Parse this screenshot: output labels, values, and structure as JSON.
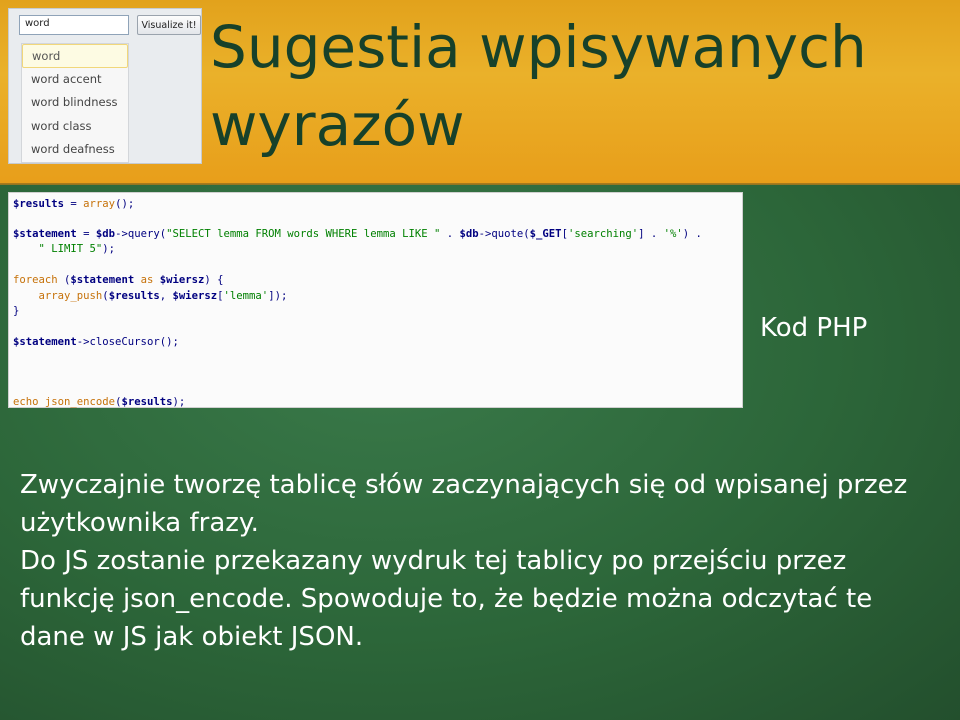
{
  "slide": {
    "title": "Sugestia wpisywanych wyrazów",
    "code_caption": "Kod PHP",
    "paragraphs": [
      "Zwyczajnie tworzę tablicę słów zaczynających się od wpisanej przez użytkownika frazy.",
      "Do JS zostanie przekazany wydruk tej tablicy po przejściu przez funkcję json_encode. Spowoduje to, że będzie można odczytać te dane w JS jak obiekt JSON."
    ]
  },
  "widget": {
    "input_value": "word",
    "button_label": "Visualize it!",
    "suggestions": [
      "word",
      "word accent",
      "word blindness",
      "word class",
      "word deafness"
    ]
  },
  "code": {
    "lines": [
      "$results = array();",
      "$statement = $db->query(\"SELECT lemma FROM words WHERE lemma LIKE \" . $db->quote($_GET['searching'] . '%') .",
      "    \" LIMIT 5\");",
      "foreach ($statement as $wiersz) {",
      "    array_push($results, $wiersz['lemma']);",
      "}",
      "$statement->closeCursor();",
      "echo json_encode($results);"
    ]
  },
  "colors": {
    "header_orange": "#e8a61f",
    "background_green": "#2f6a3f",
    "title_dark_green": "#17412a",
    "text_white": "#ffffff"
  }
}
